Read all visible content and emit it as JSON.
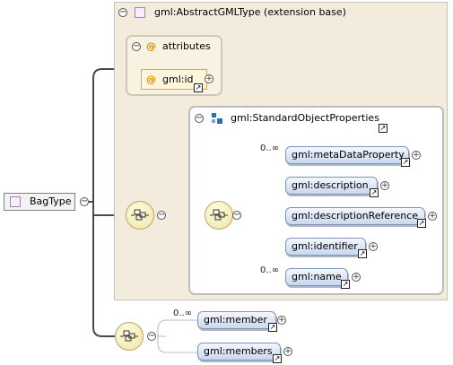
{
  "extension_base": {
    "label": "gml:AbstractGMLType (extension base)"
  },
  "attributes": {
    "label": "attributes",
    "at_symbol": "@",
    "items": [
      {
        "name": "gml:id"
      }
    ]
  },
  "group": {
    "label": "gml:StandardObjectProperties",
    "elements": [
      {
        "name": "gml:metaDataProperty",
        "cardinality": "0..∞"
      },
      {
        "name": "gml:description",
        "cardinality": ""
      },
      {
        "name": "gml:descriptionReference",
        "cardinality": ""
      },
      {
        "name": "gml:identifier",
        "cardinality": ""
      },
      {
        "name": "gml:name",
        "cardinality": "0..∞"
      }
    ]
  },
  "root": {
    "name": "BagType"
  },
  "sequence2": {
    "elements": [
      {
        "name": "gml:member",
        "cardinality": "0..∞"
      },
      {
        "name": "gml:members",
        "cardinality": ""
      }
    ]
  },
  "icons": {
    "collapse": "minus-circle-icon",
    "expand": "plus-circle-icon",
    "link": "link-arrow-icon",
    "sequence": "sequence-compositor-icon",
    "group": "group-icon"
  },
  "colors": {
    "extension_bg": "#f3ecdd",
    "element_fill": "#c9d7ee",
    "element_border": "#7e95b8",
    "sequence_fill": "#efe3a4",
    "attribute_accent": "#e08a00"
  }
}
